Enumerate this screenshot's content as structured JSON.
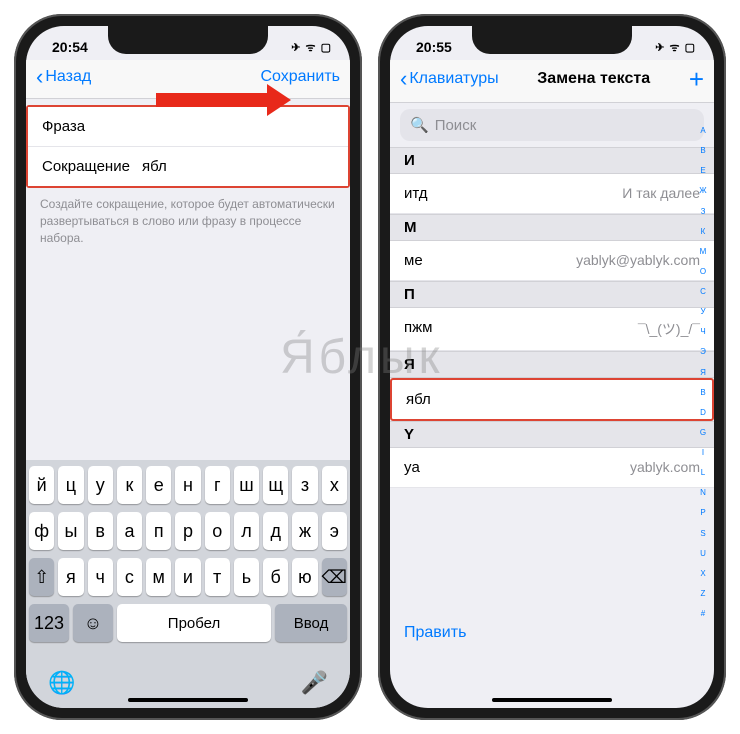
{
  "watermark": "Я́блык",
  "left": {
    "time": "20:54",
    "status_icons": "✈ ᯤ ▢",
    "back": "Назад",
    "save": "Сохранить",
    "phrase_label": "Фраза",
    "phrase_value": "",
    "shortcut_label": "Сокращение",
    "shortcut_value": "ябл",
    "hint": "Создайте сокращение, которое будет автоматически развертываться в слово или фразу в процессе набора.",
    "kb": {
      "r1": [
        "й",
        "ц",
        "у",
        "к",
        "е",
        "н",
        "г",
        "ш",
        "щ",
        "з",
        "х"
      ],
      "r2": [
        "ф",
        "ы",
        "в",
        "а",
        "п",
        "р",
        "о",
        "л",
        "д",
        "ж",
        "э"
      ],
      "r3": [
        "я",
        "ч",
        "с",
        "м",
        "и",
        "т",
        "ь",
        "б",
        "ю"
      ],
      "num": "123",
      "space": "Пробел",
      "enter": "Ввод"
    }
  },
  "right": {
    "time": "20:55",
    "status_icons": "✈ ᯤ ▢",
    "back": "Клавиатуры",
    "title": "Замена текста",
    "search_placeholder": "Поиск",
    "sections": [
      {
        "h": "И",
        "rows": [
          {
            "k": "итд",
            "v": "И так далее"
          }
        ]
      },
      {
        "h": "М",
        "rows": [
          {
            "k": "ме",
            "v": "yablyk@yablyk.com"
          }
        ]
      },
      {
        "h": "П",
        "rows": [
          {
            "k": "пжм",
            "v": "¯\\_(ツ)_/¯"
          }
        ]
      },
      {
        "h": "Я",
        "rows": [
          {
            "k": "ябл",
            "v": ""
          }
        ],
        "hl": true
      },
      {
        "h": "Y",
        "rows": [
          {
            "k": "ya",
            "v": "yablyk.com"
          }
        ]
      }
    ],
    "edit": "Править",
    "index": [
      "А",
      "В",
      "Е",
      "Ж",
      "З",
      "К",
      "М",
      "О",
      "С",
      "У",
      "Ч",
      "Э",
      "Я",
      "B",
      "D",
      "G",
      "I",
      "L",
      "N",
      "P",
      "S",
      "U",
      "X",
      "Z",
      "#"
    ]
  }
}
